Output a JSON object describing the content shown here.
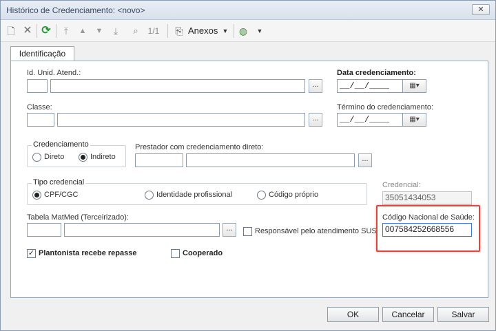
{
  "window": {
    "title": "Histórico de Credenciamento: <novo>",
    "close_label": "✕"
  },
  "toolbar": {
    "page_indicator": "1/1",
    "anexos_label": "Anexos",
    "icons": [
      "new-icon",
      "delete-icon",
      "refresh-icon",
      "first-icon",
      "prev-icon",
      "next-icon",
      "last-icon",
      "binoculars-icon",
      "attachment-icon",
      "globe-icon"
    ]
  },
  "tabs": [
    {
      "label": "Identificação"
    }
  ],
  "form": {
    "id_unid_label": "Id. Unid. Atend.:",
    "data_cred_label": "Data credenciamento:",
    "date_placeholder": "__/__/____",
    "classe_label": "Classe:",
    "termino_label": "Término do credenciamento:",
    "credenciamento_group": "Credenciamento",
    "radio_direto": "Direto",
    "radio_indireto": "Indireto",
    "prestador_label": "Prestador com credenciamento direto:",
    "tipo_group": "Tipo credencial",
    "radio_cpf": "CPF/CGC",
    "radio_identidade": "Identidade profissional",
    "radio_codigo": "Código próprio",
    "credencial_label": "Credencial:",
    "credencial_value": "35051434053",
    "tabela_label": "Tabela MatMed (Terceirizado):",
    "responsavel_label": "Responsável pelo atendimento SUS",
    "cns_label": "Código Nacional de Saúde:",
    "cns_value": "007584252668556",
    "plantonista_label": "Plantonista recebe repasse",
    "cooperado_label": "Cooperado",
    "dots": "...",
    "dropdown_glyph": "▦▾"
  },
  "buttons": {
    "ok": "OK",
    "cancel": "Cancelar",
    "save": "Salvar"
  },
  "colors": {
    "highlight": "#e0463c",
    "refresh": "#2a9a3a"
  }
}
